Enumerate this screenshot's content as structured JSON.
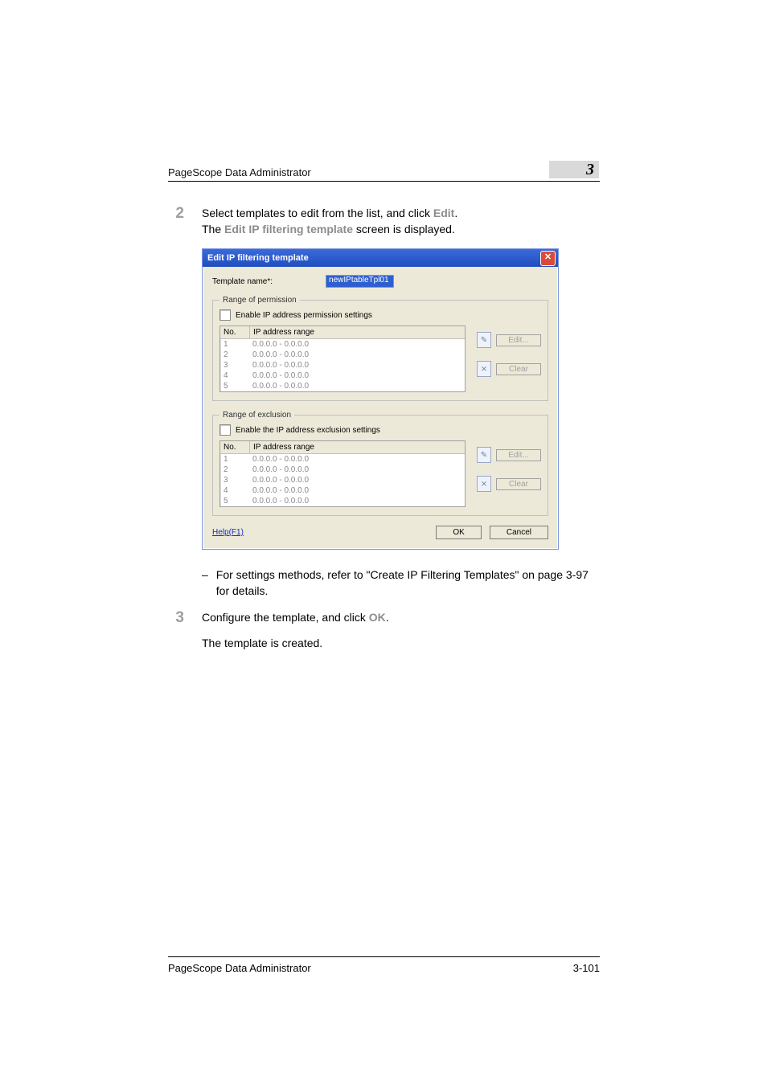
{
  "header": {
    "title": "PageScope Data Administrator",
    "chapter": "3"
  },
  "steps": {
    "s2": {
      "num": "2",
      "line1a": "Select templates to edit from the list, and click ",
      "edit": "Edit",
      "line1b": ".",
      "line2a": "The ",
      "screen": "Edit IP filtering template",
      "line2b": " screen is displayed."
    },
    "note": {
      "dash": "–",
      "text": "For settings methods, refer to \"Create IP Filtering Templates\" on page 3-97 for details."
    },
    "s3": {
      "num": "3",
      "line1a": "Configure the template, and click ",
      "ok": "OK",
      "line1b": ".",
      "line2": "The template is created."
    }
  },
  "dialog": {
    "title": "Edit IP filtering template",
    "close": "✕",
    "tn_label": "Template name*:",
    "tn_value": "newIPtableTpl01",
    "perm": {
      "legend": "Range of permission",
      "chk_label": "Enable IP address permission settings",
      "col_no": "No.",
      "col_range": "IP address range",
      "rows": [
        {
          "no": "1",
          "range": "0.0.0.0 - 0.0.0.0"
        },
        {
          "no": "2",
          "range": "0.0.0.0 - 0.0.0.0"
        },
        {
          "no": "3",
          "range": "0.0.0.0 - 0.0.0.0"
        },
        {
          "no": "4",
          "range": "0.0.0.0 - 0.0.0.0"
        },
        {
          "no": "5",
          "range": "0.0.0.0 - 0.0.0.0"
        }
      ],
      "edit_btn": "Edit...",
      "clear_btn": "Clear"
    },
    "excl": {
      "legend": "Range of exclusion",
      "chk_label": "Enable the IP address exclusion settings",
      "col_no": "No.",
      "col_range": "IP address range",
      "rows": [
        {
          "no": "1",
          "range": "0.0.0.0 - 0.0.0.0"
        },
        {
          "no": "2",
          "range": "0.0.0.0 - 0.0.0.0"
        },
        {
          "no": "3",
          "range": "0.0.0.0 - 0.0.0.0"
        },
        {
          "no": "4",
          "range": "0.0.0.0 - 0.0.0.0"
        },
        {
          "no": "5",
          "range": "0.0.0.0 - 0.0.0.0"
        }
      ],
      "edit_btn": "Edit...",
      "clear_btn": "Clear"
    },
    "help": "Help(F1)",
    "ok": "OK",
    "cancel": "Cancel"
  },
  "footer": {
    "title": "PageScope Data Administrator",
    "page": "3-101"
  }
}
